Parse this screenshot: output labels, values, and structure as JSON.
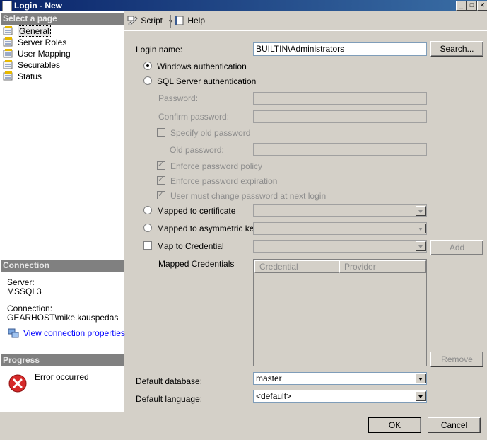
{
  "window": {
    "title": "Login - New"
  },
  "left": {
    "select_page_header": "Select a page",
    "pages": [
      "General",
      "Server Roles",
      "User Mapping",
      "Securables",
      "Status"
    ],
    "connection_header": "Connection",
    "server_label": "Server:",
    "server_value": "MSSQL3",
    "connection_label": "Connection:",
    "connection_value": "GEARHOST\\mike.kauspedas",
    "view_conn_link": "View connection properties",
    "progress_header": "Progress",
    "progress_status": "Error occurred"
  },
  "toolbar": {
    "script_label": "Script",
    "help_label": "Help"
  },
  "form": {
    "login_name_label": "Login name:",
    "login_name_value": "BUILTIN\\Administrators",
    "search_button": "Search...",
    "windows_auth": "Windows authentication",
    "sql_auth": "SQL Server authentication",
    "password_label": "Password:",
    "confirm_password_label": "Confirm password:",
    "specify_old_password": "Specify old password",
    "old_password_label": "Old password:",
    "enforce_policy": "Enforce password policy",
    "enforce_expiration": "Enforce password expiration",
    "must_change": "User must change password at next login",
    "mapped_cert": "Mapped to certificate",
    "mapped_asym": "Mapped to asymmetric key",
    "map_credential": "Map to Credential",
    "add_button": "Add",
    "mapped_credentials_label": "Mapped Credentials",
    "cred_columns": [
      "Credential",
      "Provider"
    ],
    "remove_button": "Remove",
    "default_db_label": "Default database:",
    "default_db_value": "master",
    "default_lang_label": "Default language:",
    "default_lang_value": "<default>"
  },
  "footer": {
    "ok_button": "OK",
    "cancel_button": "Cancel"
  }
}
